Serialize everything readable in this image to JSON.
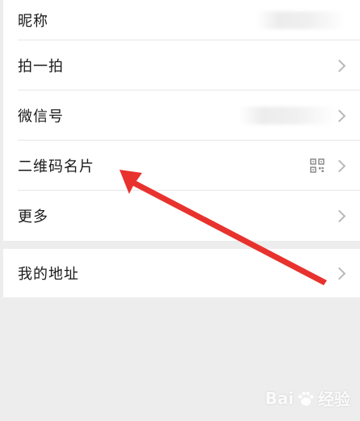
{
  "menu": {
    "items": [
      {
        "label": "昵称"
      },
      {
        "label": "拍一拍"
      },
      {
        "label": "微信号"
      },
      {
        "label": "二维码名片"
      },
      {
        "label": "更多"
      }
    ],
    "address": {
      "label": "我的地址"
    }
  },
  "icons": {
    "chevron": "chevron-right-icon",
    "qr": "qr-code-icon"
  },
  "annotation": {
    "arrow_color": "#e8322e"
  },
  "watermark": {
    "brand": "Bai",
    "brand_suffix": "经验"
  }
}
